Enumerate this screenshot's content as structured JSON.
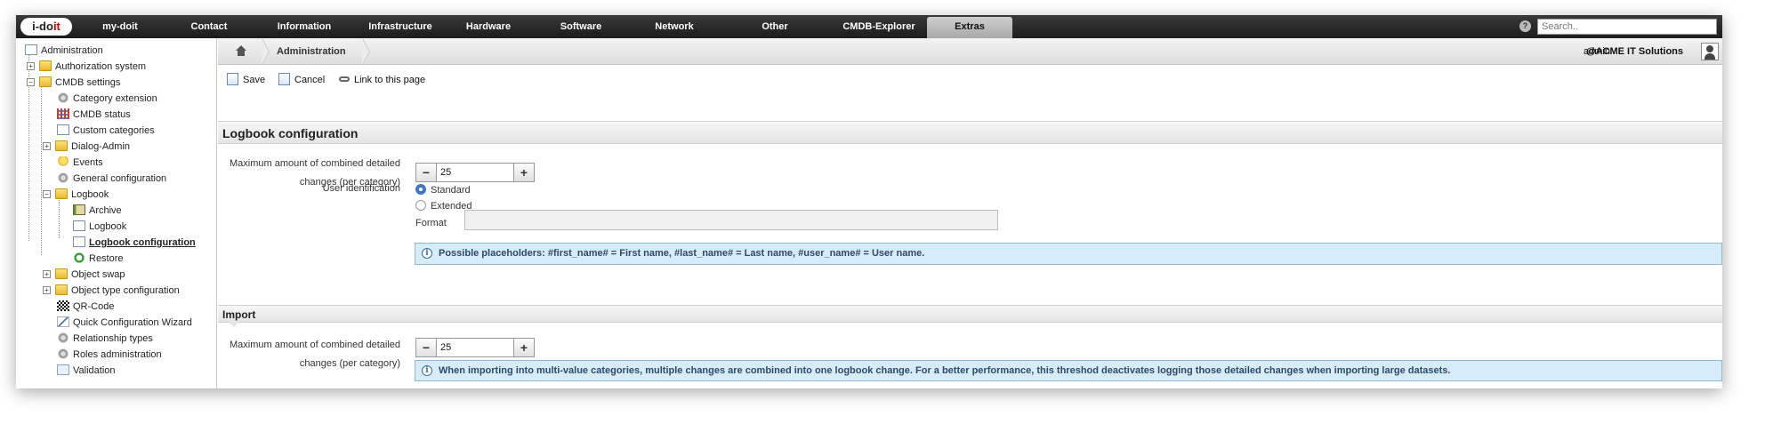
{
  "nav": {
    "logo_prefix": "i-do",
    "logo_suffix": "it",
    "items": [
      {
        "label": "my-doit"
      },
      {
        "label": "Contact"
      },
      {
        "label": "Information"
      },
      {
        "label": "Infrastructure"
      },
      {
        "label": "Hardware"
      },
      {
        "label": "Software"
      },
      {
        "label": "Network"
      },
      {
        "label": "Other"
      },
      {
        "label": "CMDB-Explorer"
      },
      {
        "label": "Extras"
      }
    ],
    "active": "Extras",
    "search_placeholder": "Search.."
  },
  "sidebar": {
    "items": [
      {
        "label": "Administration",
        "icon": "grid-page-icon"
      },
      {
        "label": "Authorization system",
        "icon": "folder-icon"
      },
      {
        "label": "CMDB settings",
        "icon": "folder-icon"
      },
      {
        "label": "Category extension",
        "icon": "gear-icon"
      },
      {
        "label": "CMDB status",
        "icon": "grid-icon"
      },
      {
        "label": "Custom categories",
        "icon": "page-icon"
      },
      {
        "label": "Dialog-Admin",
        "icon": "folder-icon"
      },
      {
        "label": "Events",
        "icon": "bulb-icon"
      },
      {
        "label": "General configuration",
        "icon": "gear-icon"
      },
      {
        "label": "Logbook",
        "icon": "folder-icon"
      },
      {
        "label": "Archive",
        "icon": "book-icon"
      },
      {
        "label": "Logbook",
        "icon": "page-icon"
      },
      {
        "label": "Logbook configuration",
        "icon": "page-icon"
      },
      {
        "label": "Restore",
        "icon": "recycle-icon"
      },
      {
        "label": "Object swap",
        "icon": "folder-icon"
      },
      {
        "label": "Object type configuration",
        "icon": "folder-icon"
      },
      {
        "label": "QR-Code",
        "icon": "qr-icon"
      },
      {
        "label": "Quick Configuration Wizard",
        "icon": "wand-icon"
      },
      {
        "label": "Relationship types",
        "icon": "gear-icon"
      },
      {
        "label": "Roles administration",
        "icon": "gear-icon"
      },
      {
        "label": "Validation",
        "icon": "check-icon"
      }
    ],
    "selected": "Logbook configuration"
  },
  "header": {
    "breadcrumb": "Administration",
    "user": "admin",
    "company": "@ACME IT Solutions"
  },
  "toolbar": {
    "save_label": "Save",
    "cancel_label": "Cancel",
    "link_label": "Link to this page"
  },
  "logbook": {
    "title": "Logbook configuration",
    "max_label_line1": "Maximum amount of combined detailed",
    "max_label_line2": "changes (per category)",
    "max_value": "25",
    "user_ident_label": "User identification",
    "radio_standard": "Standard",
    "radio_extended": "Extended",
    "selected_ident": "Standard",
    "format_label": "Format",
    "info": "Possible placeholders: #first_name# = First name, #last_name# = Last name, #user_name# = User name."
  },
  "import": {
    "title": "Import",
    "max_label_line1": "Maximum amount of combined detailed",
    "max_label_line2": "changes (per category)",
    "max_value": "25",
    "info": "When importing into multi-value categories, multiple changes are combined into one logbook change. For a better performance, this threshod deactivates logging those detailed changes when importing large datasets."
  },
  "colors": {
    "nav_bg": "#1c1c1c",
    "info_bg": "#d6ecf8",
    "info_border": "#8cbbdd",
    "logo_accent": "#cc0000"
  }
}
